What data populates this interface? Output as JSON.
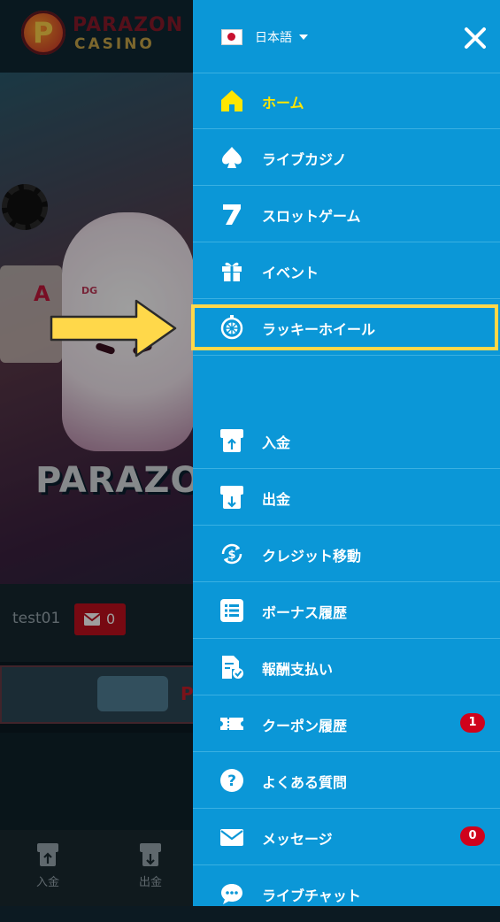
{
  "background": {
    "logo_top": "PARAZON",
    "logo_bottom": "CASINO",
    "logo_mark": "P",
    "banner_title": "PARAZO",
    "banner_card": "A",
    "banner_tag": "DG",
    "username": "test01",
    "mail_count": "0",
    "promo_letter": "P",
    "bottom_nav": [
      {
        "label": "入金",
        "icon": "deposit-icon"
      },
      {
        "label": "出金",
        "icon": "withdraw-icon"
      }
    ]
  },
  "drawer": {
    "language": "日本語",
    "close_icon": "close-icon",
    "menu": [
      {
        "label": "ホーム",
        "icon": "home-icon",
        "active": true
      },
      {
        "label": "ライブカジノ",
        "icon": "spade-icon"
      },
      {
        "label": "スロットゲーム",
        "icon": "seven-icon"
      },
      {
        "label": "イベント",
        "icon": "gift-icon"
      },
      {
        "label": "ラッキーホイール",
        "icon": "wheel-icon",
        "highlighted": true
      },
      {
        "label": "入金",
        "icon": "deposit-icon"
      },
      {
        "label": "出金",
        "icon": "withdraw-icon"
      },
      {
        "label": "クレジット移動",
        "icon": "credit-transfer-icon"
      },
      {
        "label": "ボーナス履歴",
        "icon": "list-icon"
      },
      {
        "label": "報酬支払い",
        "icon": "reward-document-icon"
      },
      {
        "label": "クーポン履歴",
        "icon": "coupon-icon",
        "badge": "1"
      },
      {
        "label": "よくある質問",
        "icon": "question-icon"
      },
      {
        "label": "メッセージ",
        "icon": "mail-icon",
        "badge": "0"
      },
      {
        "label": "ライブチャット",
        "icon": "chat-icon"
      }
    ]
  },
  "colors": {
    "drawer_bg": "#0b97d7",
    "active_text": "#ffe600",
    "highlight": "#ffd84a",
    "badge": "#d0021b"
  }
}
